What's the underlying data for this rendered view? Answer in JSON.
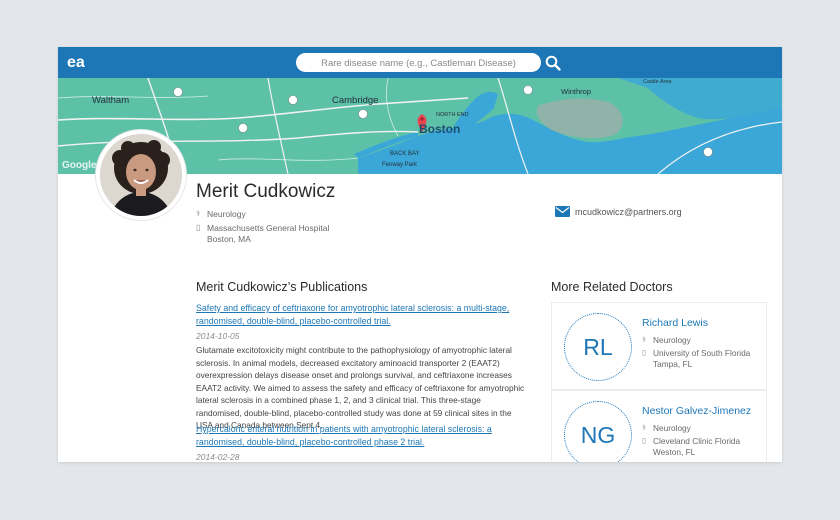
{
  "header": {
    "logo_text": "ea",
    "search_placeholder": "Rare disease name (e.g., Castleman Disease)",
    "search_icon": "search-icon"
  },
  "map": {
    "labels": {
      "waltham": "Waltham",
      "cambridge": "Cambridge",
      "boston": "Boston",
      "winthrop": "Winthrop",
      "back_bay": "BACK BAY",
      "fenway": "Fenway Park",
      "google": "Google",
      "north_end": "NORTH END",
      "castle_area": "Castle Area"
    },
    "colors": {
      "land": "#5dc1a8",
      "water": "#3ba7d8",
      "pin": "#e8474f"
    }
  },
  "profile": {
    "name": "Merit Cudkowicz",
    "specialty": "Neurology",
    "hospital": "Massachusetts General Hospital",
    "city": "Boston, MA",
    "email": "mcudkowicz@partners.org"
  },
  "publications": {
    "heading": "Merit Cudkowicz’s Publications",
    "items": [
      {
        "title": "Safety and efficacy of ceftriaxone for amyotrophic lateral sclerosis: a multi-stage, randomised, double-blind, placebo-controlled trial.",
        "date": "2014-10-05",
        "abstract": "Glutamate excitotoxicity might contribute to the pathophysiology of amyotrophic lateral sclerosis. In animal models, decreased excitatory aminoacid transporter 2 (EAAT2) overexpression delays disease onset and prolongs survival, and ceftriaxone increases EAAT2 activity. We aimed to assess the safety and efficacy of ceftriaxone for amyotrophic lateral sclerosis in a combined phase 1, 2, and 3 clinical trial. This three-stage randomised, double-blind, placebo-controlled study was done at 59 clinical sites in the USA and Canada between Sept 4,"
      },
      {
        "title": "Hypercaloric enteral nutrition in patients with amyotrophic lateral sclerosis: a randomised, double-blind, placebo-controlled phase 2 trial.",
        "date": "2014-02-28"
      }
    ]
  },
  "related": {
    "heading": "More Related Doctors",
    "doctors": [
      {
        "initials": "RL",
        "name": "Richard Lewis",
        "specialty": "Neurology",
        "institution": "University of South Florida",
        "city": "Tampa, FL"
      },
      {
        "initials": "NG",
        "name": "Nestor Galvez-Jimenez",
        "specialty": "Neurology",
        "institution": "Cleveland Clinic Florida",
        "city": "Weston, FL"
      }
    ]
  },
  "colors": {
    "accent": "#1d77b6",
    "background": "#e3e6ea"
  }
}
